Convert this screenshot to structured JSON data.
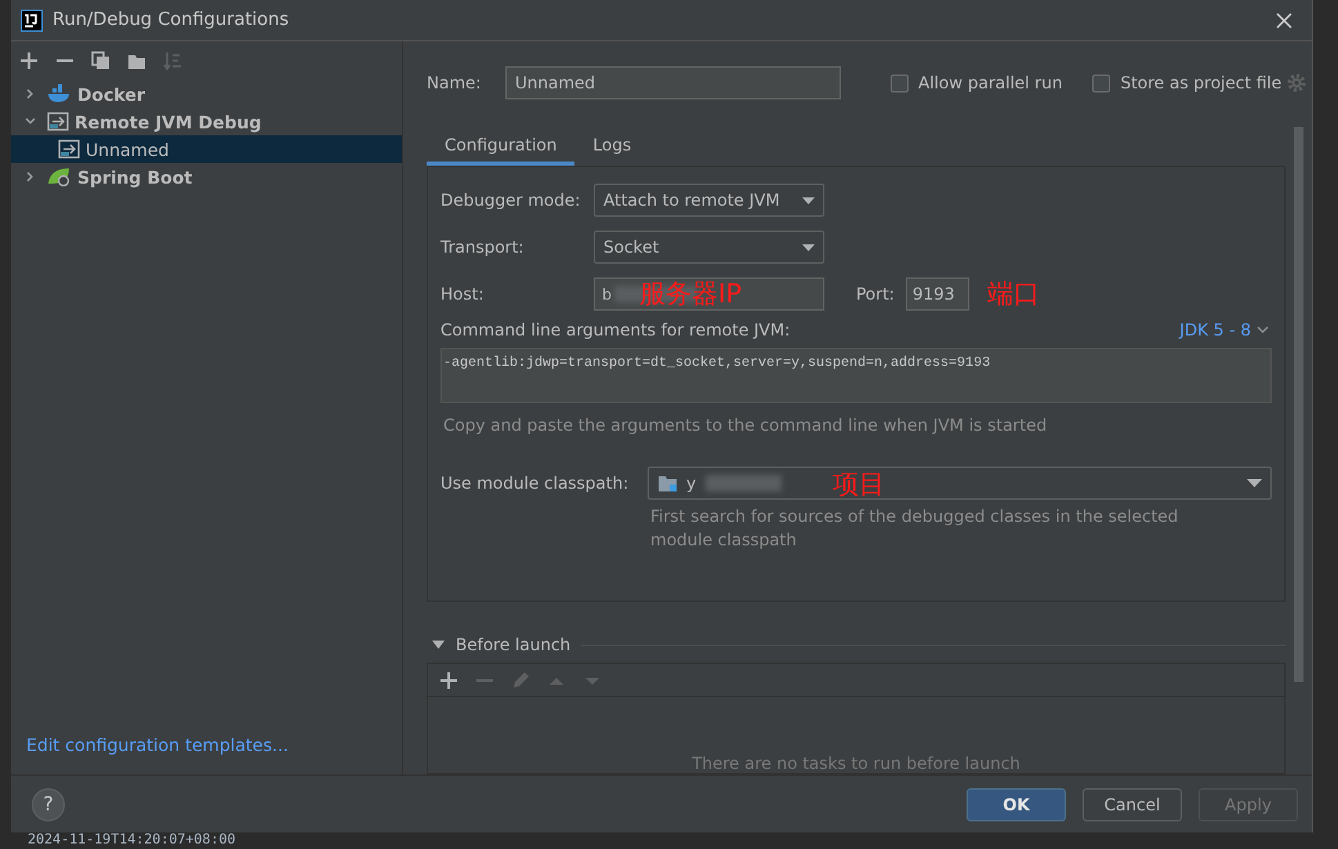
{
  "window": {
    "title": "Run/Debug Configurations"
  },
  "toolbar": [
    {
      "kind": "add",
      "disabled": false
    },
    {
      "kind": "remove",
      "disabled": false
    },
    {
      "kind": "copy",
      "disabled": false
    },
    {
      "kind": "folder",
      "disabled": false
    },
    {
      "kind": "sort",
      "disabled": true
    }
  ],
  "tree": [
    {
      "label": "Docker",
      "kind": "docker",
      "expanded": false,
      "selected": false
    },
    {
      "label": "Remote JVM Debug",
      "kind": "remote",
      "expanded": true,
      "selected": false,
      "children": [
        {
          "label": "Unnamed",
          "kind": "remote",
          "selected": true
        }
      ]
    },
    {
      "label": "Spring Boot",
      "kind": "spring",
      "expanded": false,
      "selected": false
    }
  ],
  "templates_link": "Edit configuration templates...",
  "name_field": {
    "label": "Name:",
    "value": "Unnamed"
  },
  "options": [
    {
      "label": "Allow parallel run",
      "checked": false
    },
    {
      "label": "Store as project file",
      "checked": false
    }
  ],
  "tabs": [
    {
      "label": "Configuration",
      "selected": true
    },
    {
      "label": "Logs",
      "selected": false
    }
  ],
  "debugger_mode": {
    "label": "Debugger mode:",
    "value": "Attach to remote JVM"
  },
  "transport": {
    "label": "Transport:",
    "value": "Socket"
  },
  "host": {
    "label": "Host:",
    "value": "b",
    "redacted": true,
    "annotation": "服务器IP"
  },
  "port": {
    "label": "Port:",
    "value": "9193",
    "annotation": "端口"
  },
  "command_line": {
    "label": "Command line arguments for remote JVM:",
    "jdk": "JDK 5 - 8",
    "value": "-agentlib:jdwp=transport=dt_socket,server=y,suspend=n,address=9193",
    "hint": "Copy and paste the arguments to the command line when JVM is started"
  },
  "module": {
    "label": "Use module classpath:",
    "value": "y",
    "redacted": true,
    "annotation": "项目",
    "hint": "First search for sources of the debugged classes in the selected module classpath"
  },
  "before_launch": {
    "label": "Before launch",
    "expanded": true,
    "toolbar": [
      {
        "kind": "add",
        "disabled": false
      },
      {
        "kind": "remove",
        "disabled": true
      },
      {
        "kind": "edit",
        "disabled": true
      },
      {
        "kind": "up",
        "disabled": true
      },
      {
        "kind": "down",
        "disabled": true
      }
    ],
    "empty_text": "There are no tasks to run before launch"
  },
  "buttons": [
    {
      "label": "OK",
      "kind": "default",
      "disabled": false
    },
    {
      "label": "Cancel",
      "kind": "normal",
      "disabled": false
    },
    {
      "label": "Apply",
      "kind": "normal",
      "disabled": true
    }
  ],
  "help": "?",
  "background": {
    "log_line": "2024-11-19T14:20:07+08:00"
  }
}
